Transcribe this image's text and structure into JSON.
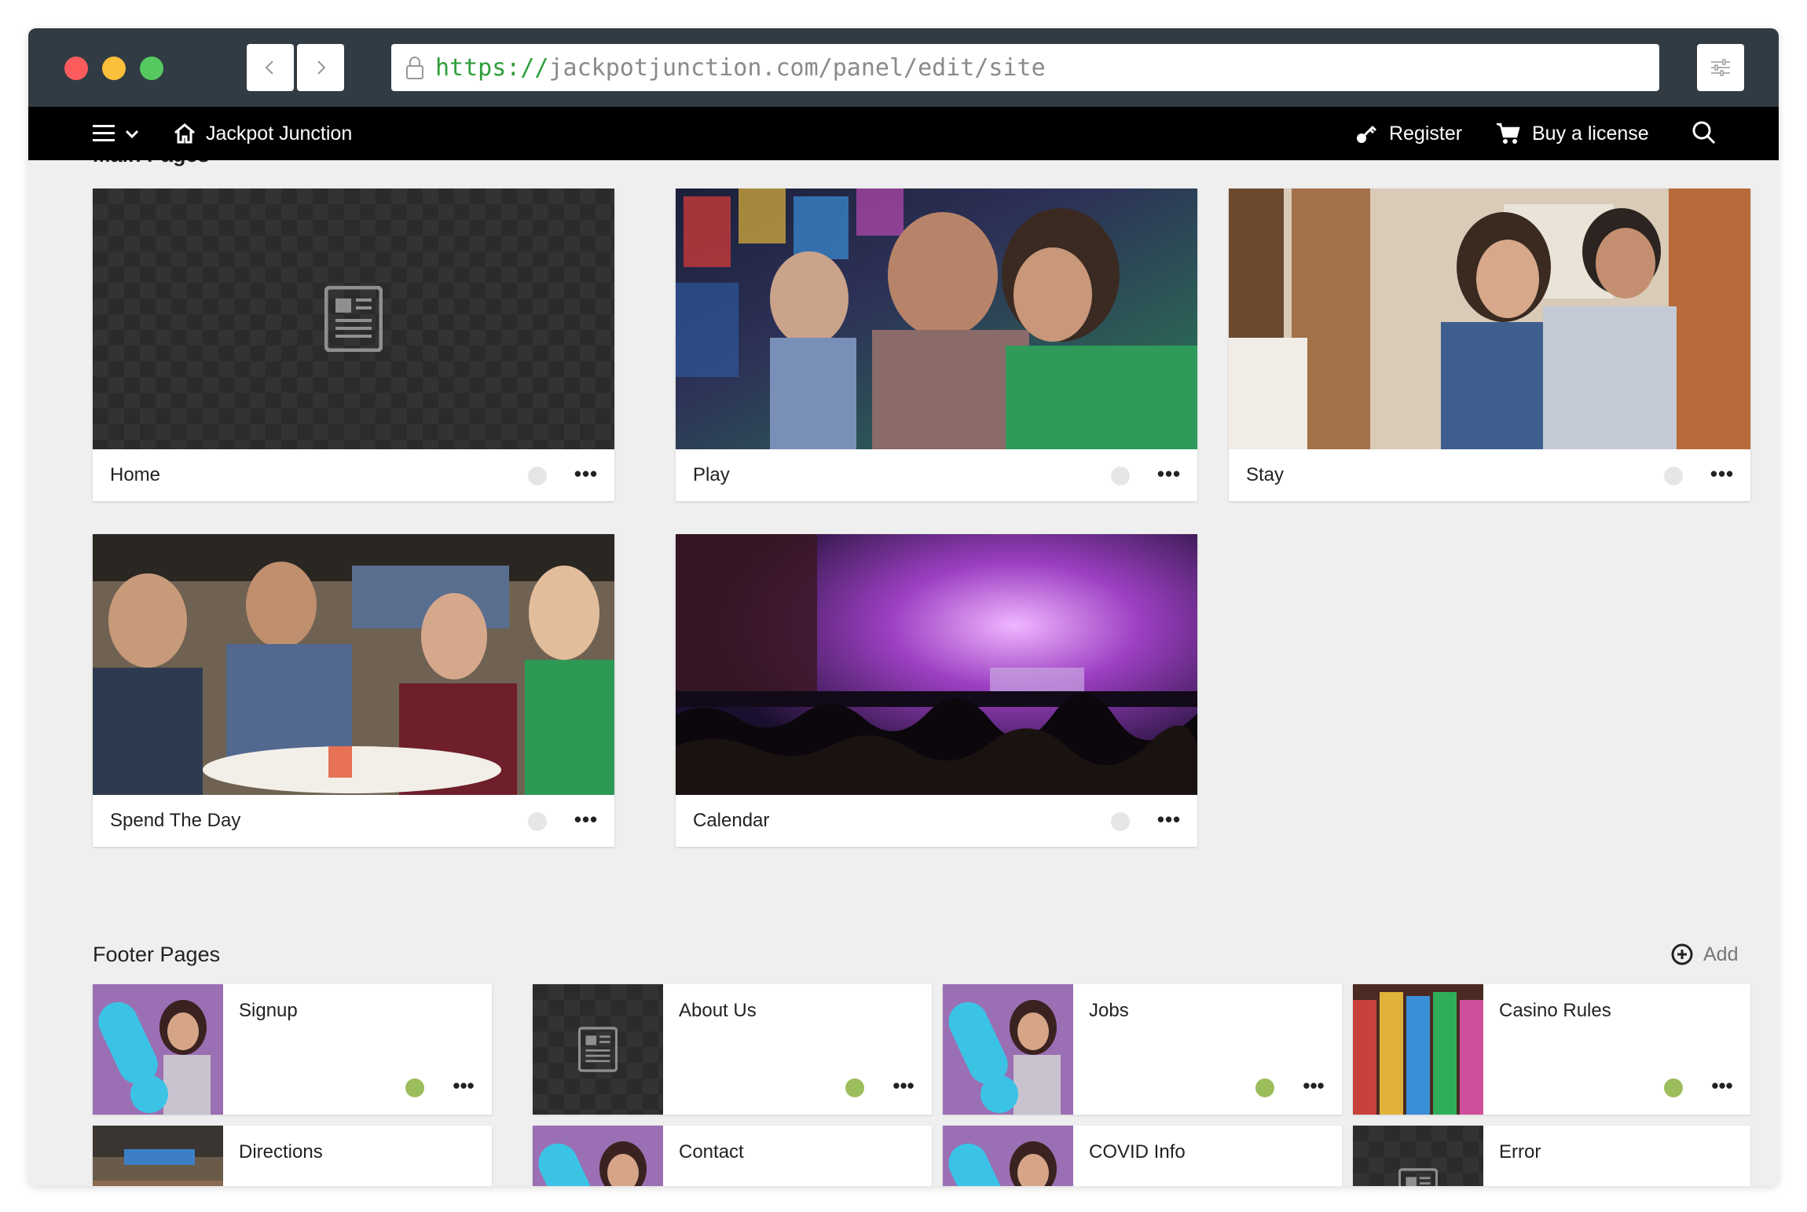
{
  "browser": {
    "url_protocol": "https://",
    "url_rest": "jackpotjunction.com/panel/edit/site"
  },
  "appbar": {
    "site_name": "Jackpot Junction",
    "register_label": "Register",
    "buy_label": "Buy a license"
  },
  "main_pages": {
    "title": "Main Pages",
    "cards": [
      {
        "label": "Home",
        "more": "•••"
      },
      {
        "label": "Play",
        "more": "•••"
      },
      {
        "label": "Stay",
        "more": "•••"
      },
      {
        "label": "Spend The Day",
        "more": "•••"
      },
      {
        "label": "Calendar",
        "more": "•••"
      }
    ]
  },
  "footer_pages": {
    "title": "Footer Pages",
    "add_label": "Add",
    "cards": [
      {
        "label": "Signup",
        "more": "•••"
      },
      {
        "label": "About Us",
        "more": "•••"
      },
      {
        "label": "Jobs",
        "more": "•••"
      },
      {
        "label": "Casino Rules",
        "more": "•••"
      },
      {
        "label": "Directions"
      },
      {
        "label": "Contact"
      },
      {
        "label": "COVID Info"
      },
      {
        "label": "Error"
      }
    ]
  },
  "colors": {
    "chrome": "#313b43",
    "appbar": "#000000",
    "status_active": "#9cbd5b",
    "status_inactive": "#e6e6e6",
    "url_protocol": "#2e9e3a"
  }
}
